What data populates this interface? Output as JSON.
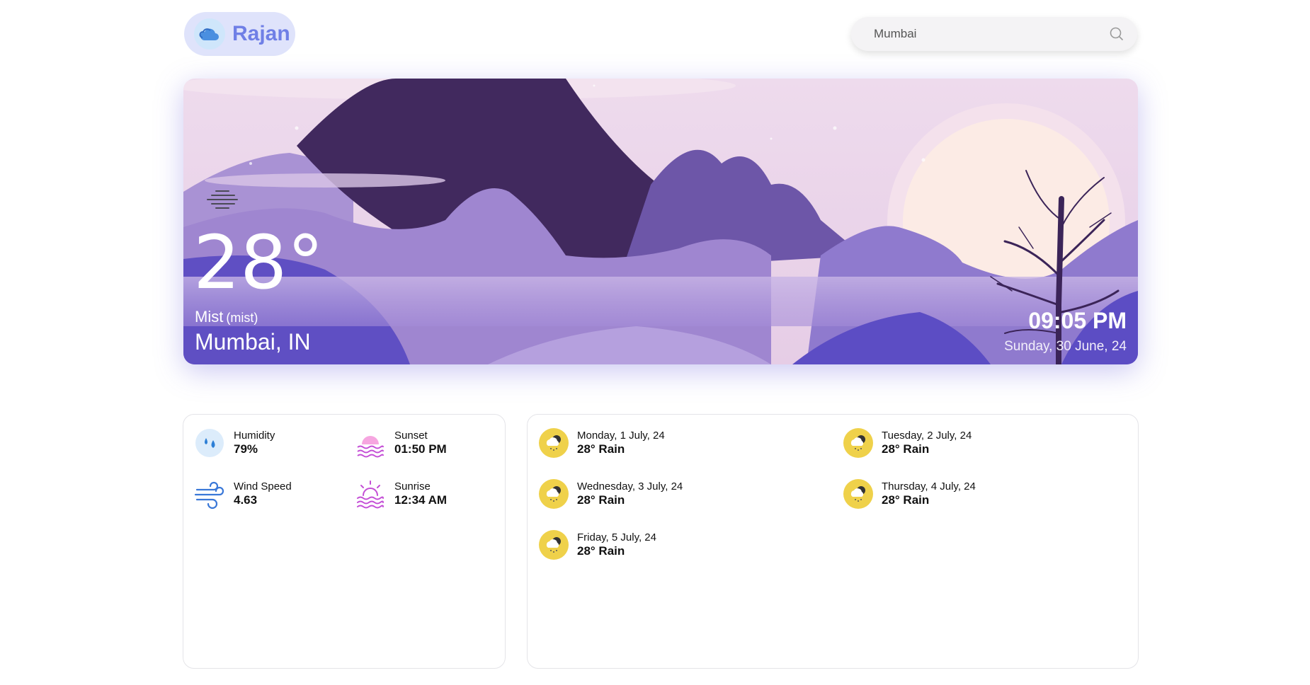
{
  "brand": {
    "name": "Rajan",
    "icon": "cloud-icon"
  },
  "search": {
    "value": "Mumbai",
    "icon": "search-icon"
  },
  "current": {
    "temperature": "28°",
    "condition": "Mist",
    "description": "(mist)",
    "location": "Mumbai, IN",
    "time": "09:05 PM",
    "date": "Sunday, 30 June, 24",
    "icon": "mist-icon"
  },
  "highlights": [
    {
      "label": "Humidity",
      "value": "79%",
      "icon": "humidity-icon"
    },
    {
      "label": "Sunset",
      "value": "01:50 PM",
      "icon": "sunset-icon"
    },
    {
      "label": "Wind Speed",
      "value": "4.63",
      "icon": "wind-icon"
    },
    {
      "label": "Sunrise",
      "value": "12:34 AM",
      "icon": "sunrise-icon"
    }
  ],
  "forecast": [
    {
      "date": "Monday, 1 July, 24",
      "summary": "28° Rain",
      "icon": "rain-icon"
    },
    {
      "date": "Tuesday, 2 July, 24",
      "summary": "28° Rain",
      "icon": "rain-icon"
    },
    {
      "date": "Wednesday, 3 July, 24",
      "summary": "28° Rain",
      "icon": "rain-icon"
    },
    {
      "date": "Thursday, 4 July, 24",
      "summary": "28° Rain",
      "icon": "rain-icon"
    },
    {
      "date": "Friday, 5 July, 24",
      "summary": "28° Rain",
      "icon": "rain-icon"
    }
  ],
  "colors": {
    "accent": "#6f7fe6",
    "hero_purple": "#6656c8",
    "forecast_icon_bg": "#efd14a"
  }
}
